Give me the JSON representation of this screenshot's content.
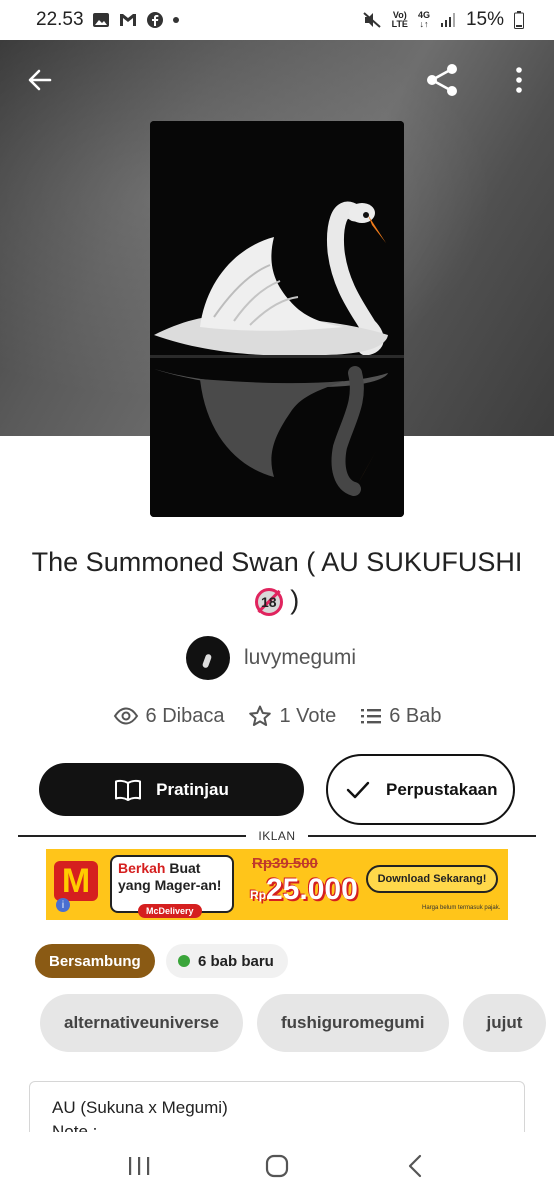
{
  "status_bar": {
    "time": "22.53",
    "network_top": "Vo)",
    "network_bottom": "LTE",
    "signal_label": "4G",
    "battery": "15%"
  },
  "header": {
    "back_icon": "arrow-left-icon",
    "share_icon": "share-icon",
    "more_icon": "more-vertical-icon"
  },
  "story": {
    "title": "The Summoned Swan ( AU SUKUFUSHI",
    "title_badge": "18",
    "title_close": ")",
    "author": "luvymegumi",
    "stats": {
      "reads": "6 Dibaca",
      "votes": "1 Vote",
      "parts": "6 Bab"
    }
  },
  "actions": {
    "preview_label": "Pratinjau",
    "library_label": "Perpustakaan"
  },
  "ad": {
    "divider_label": "IKLAN",
    "headline_red": "Berkah",
    "headline_rest": " Buat yang Mager-an!",
    "tagline": "McDelivery",
    "old_price": "Rp39.500",
    "new_price_prefix": "Rp",
    "new_price": "25.000",
    "cta": "Download Sekarang!",
    "fine_print": "Harga belum termasuk pajak."
  },
  "status_tags": {
    "status": "Bersambung",
    "new_parts": "6 bab baru"
  },
  "tags": [
    "alternativeuniverse",
    "fushiguromegumi",
    "jujut"
  ],
  "description": {
    "line1": "AU (Sukuna x Megumi)",
    "line2": "Note :"
  },
  "colors": {
    "primary_button": "#121212",
    "status_tag": "#8a5a14",
    "new_dot": "#3aa53a",
    "ad_background": "#ffc51a"
  }
}
